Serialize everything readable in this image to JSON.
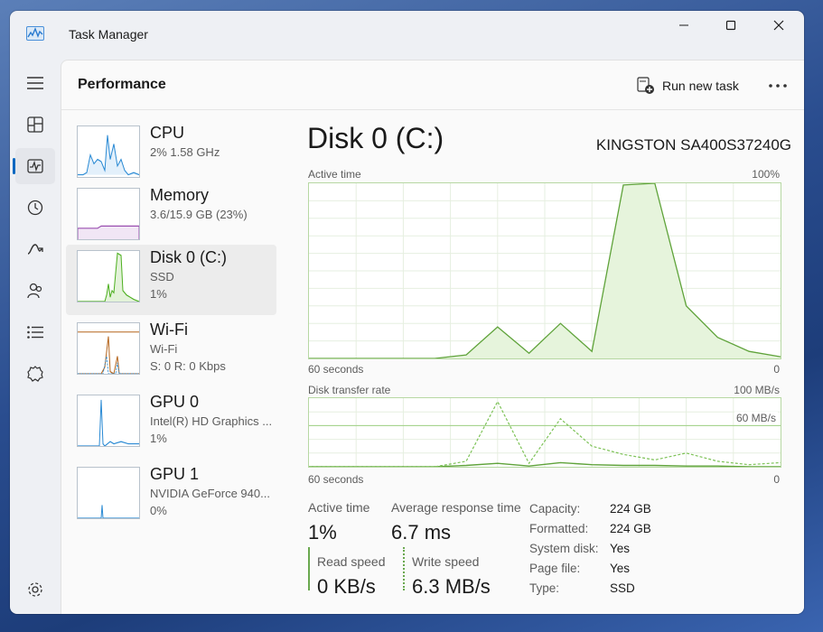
{
  "window": {
    "title": "Task Manager"
  },
  "header": {
    "title": "Performance",
    "run_new_task": "Run new task"
  },
  "rail": {
    "items": [
      "menu-icon",
      "processes-icon",
      "performance-icon",
      "app-history-icon",
      "startup-apps-icon",
      "users-icon",
      "details-icon",
      "services-icon"
    ],
    "settings": "gear-icon"
  },
  "devices": [
    {
      "name": "CPU",
      "sub1": "2%  1.58 GHz",
      "sub2": "",
      "color": "#2a8ad4"
    },
    {
      "name": "Memory",
      "sub1": "3.6/15.9 GB (23%)",
      "sub2": "",
      "color": "#9a4fb0"
    },
    {
      "name": "Disk 0 (C:)",
      "sub1": "SSD",
      "sub2": "1%",
      "color": "#4caf1f"
    },
    {
      "name": "Wi-Fi",
      "sub1": "Wi-Fi",
      "sub2": "S: 0  R: 0 Kbps",
      "color": "#b5651d"
    },
    {
      "name": "GPU 0",
      "sub1": "Intel(R) HD Graphics ...",
      "sub2": "1%",
      "color": "#2a8ad4"
    },
    {
      "name": "GPU 1",
      "sub1": "NVIDIA GeForce 940...",
      "sub2": "0%",
      "color": "#2a8ad4"
    }
  ],
  "detail": {
    "title": "Disk 0 (C:)",
    "model": "KINGSTON SA400S37240G",
    "graph1": {
      "label": "Active time",
      "max": "100%",
      "time": "60 seconds",
      "min": "0"
    },
    "graph2": {
      "label": "Disk transfer rate",
      "max": "100 MB/s",
      "mid": "60 MB/s",
      "time": "60 seconds",
      "min": "0"
    },
    "stats": {
      "active_time_label": "Active time",
      "active_time": "1%",
      "avg_resp_label": "Average response time",
      "avg_resp": "6.7 ms",
      "read_label": "Read speed",
      "read": "0 KB/s",
      "write_label": "Write speed",
      "write": "6.3 MB/s"
    },
    "props": [
      {
        "label": "Capacity:",
        "value": "224 GB"
      },
      {
        "label": "Formatted:",
        "value": "224 GB"
      },
      {
        "label": "System disk:",
        "value": "Yes"
      },
      {
        "label": "Page file:",
        "value": "Yes"
      },
      {
        "label": "Type:",
        "value": "SSD"
      }
    ]
  },
  "chart_data": [
    {
      "type": "area",
      "title": "Active time",
      "ylim": [
        0,
        100
      ],
      "x": [
        60,
        56,
        52,
        48,
        44,
        40,
        36,
        32,
        28,
        24,
        20,
        16,
        12,
        8,
        4,
        0
      ],
      "values": [
        0,
        0,
        0,
        0,
        0,
        2,
        18,
        3,
        20,
        4,
        99,
        100,
        30,
        12,
        4,
        1
      ]
    },
    {
      "type": "line",
      "title": "Disk transfer rate",
      "ylim": [
        0,
        100
      ],
      "x": [
        60,
        56,
        52,
        48,
        44,
        40,
        36,
        32,
        28,
        24,
        20,
        16,
        12,
        8,
        4,
        0
      ],
      "series": [
        {
          "name": "Read speed",
          "values": [
            0,
            0,
            0,
            0,
            0,
            2,
            5,
            1,
            6,
            3,
            2,
            2,
            1,
            1,
            0,
            0
          ]
        },
        {
          "name": "Write speed",
          "values": [
            0,
            0,
            0,
            0,
            0,
            8,
            95,
            5,
            70,
            30,
            18,
            10,
            20,
            8,
            3,
            6
          ]
        }
      ]
    }
  ]
}
